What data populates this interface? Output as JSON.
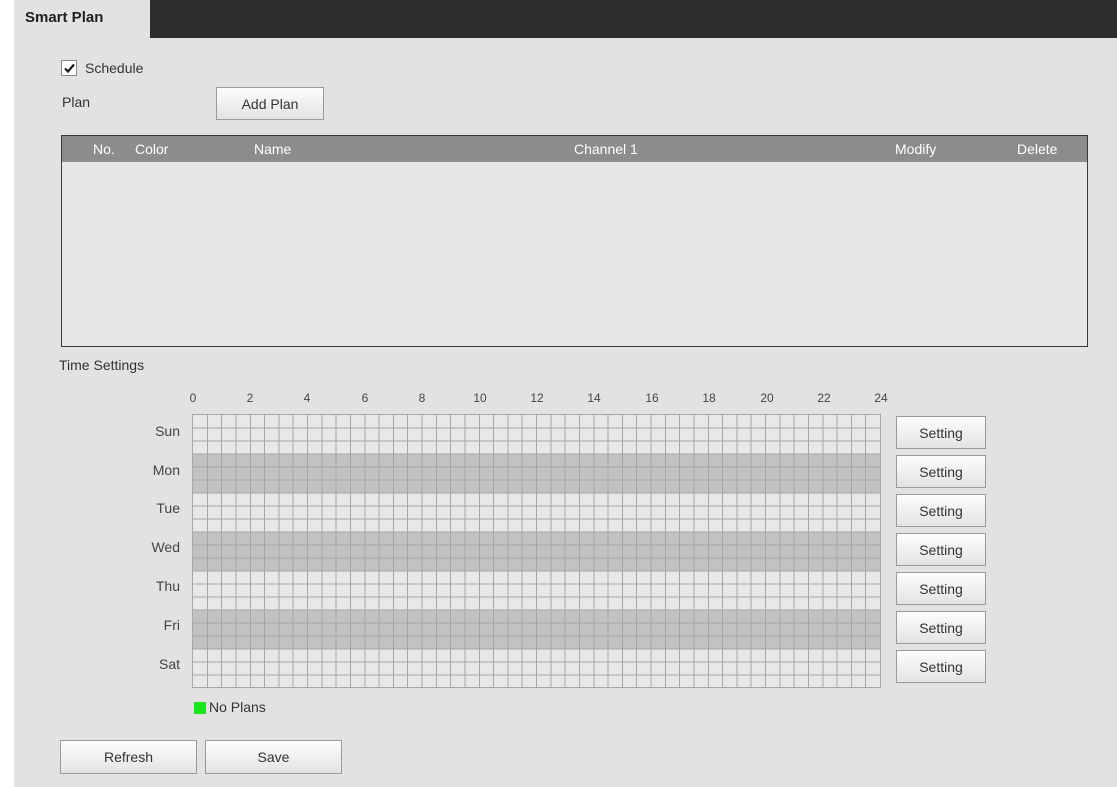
{
  "tab": {
    "label": "Smart Plan"
  },
  "schedule": {
    "label": "Schedule",
    "checked": true
  },
  "plan": {
    "label": "Plan",
    "add_button": "Add Plan"
  },
  "table": {
    "columns": [
      "No.",
      "Color",
      "Name",
      "Channel 1",
      "Modify",
      "Delete"
    ],
    "rows": []
  },
  "time_settings": {
    "title": "Time Settings",
    "hours": [
      "0",
      "2",
      "4",
      "6",
      "8",
      "10",
      "12",
      "14",
      "16",
      "18",
      "20",
      "22",
      "24"
    ],
    "days": [
      "Sun",
      "Mon",
      "Tue",
      "Wed",
      "Thu",
      "Fri",
      "Sat"
    ],
    "setting_label": "Setting"
  },
  "legend": {
    "label": "No Plans",
    "color": "#19e619"
  },
  "footer": {
    "refresh": "Refresh",
    "save": "Save"
  }
}
